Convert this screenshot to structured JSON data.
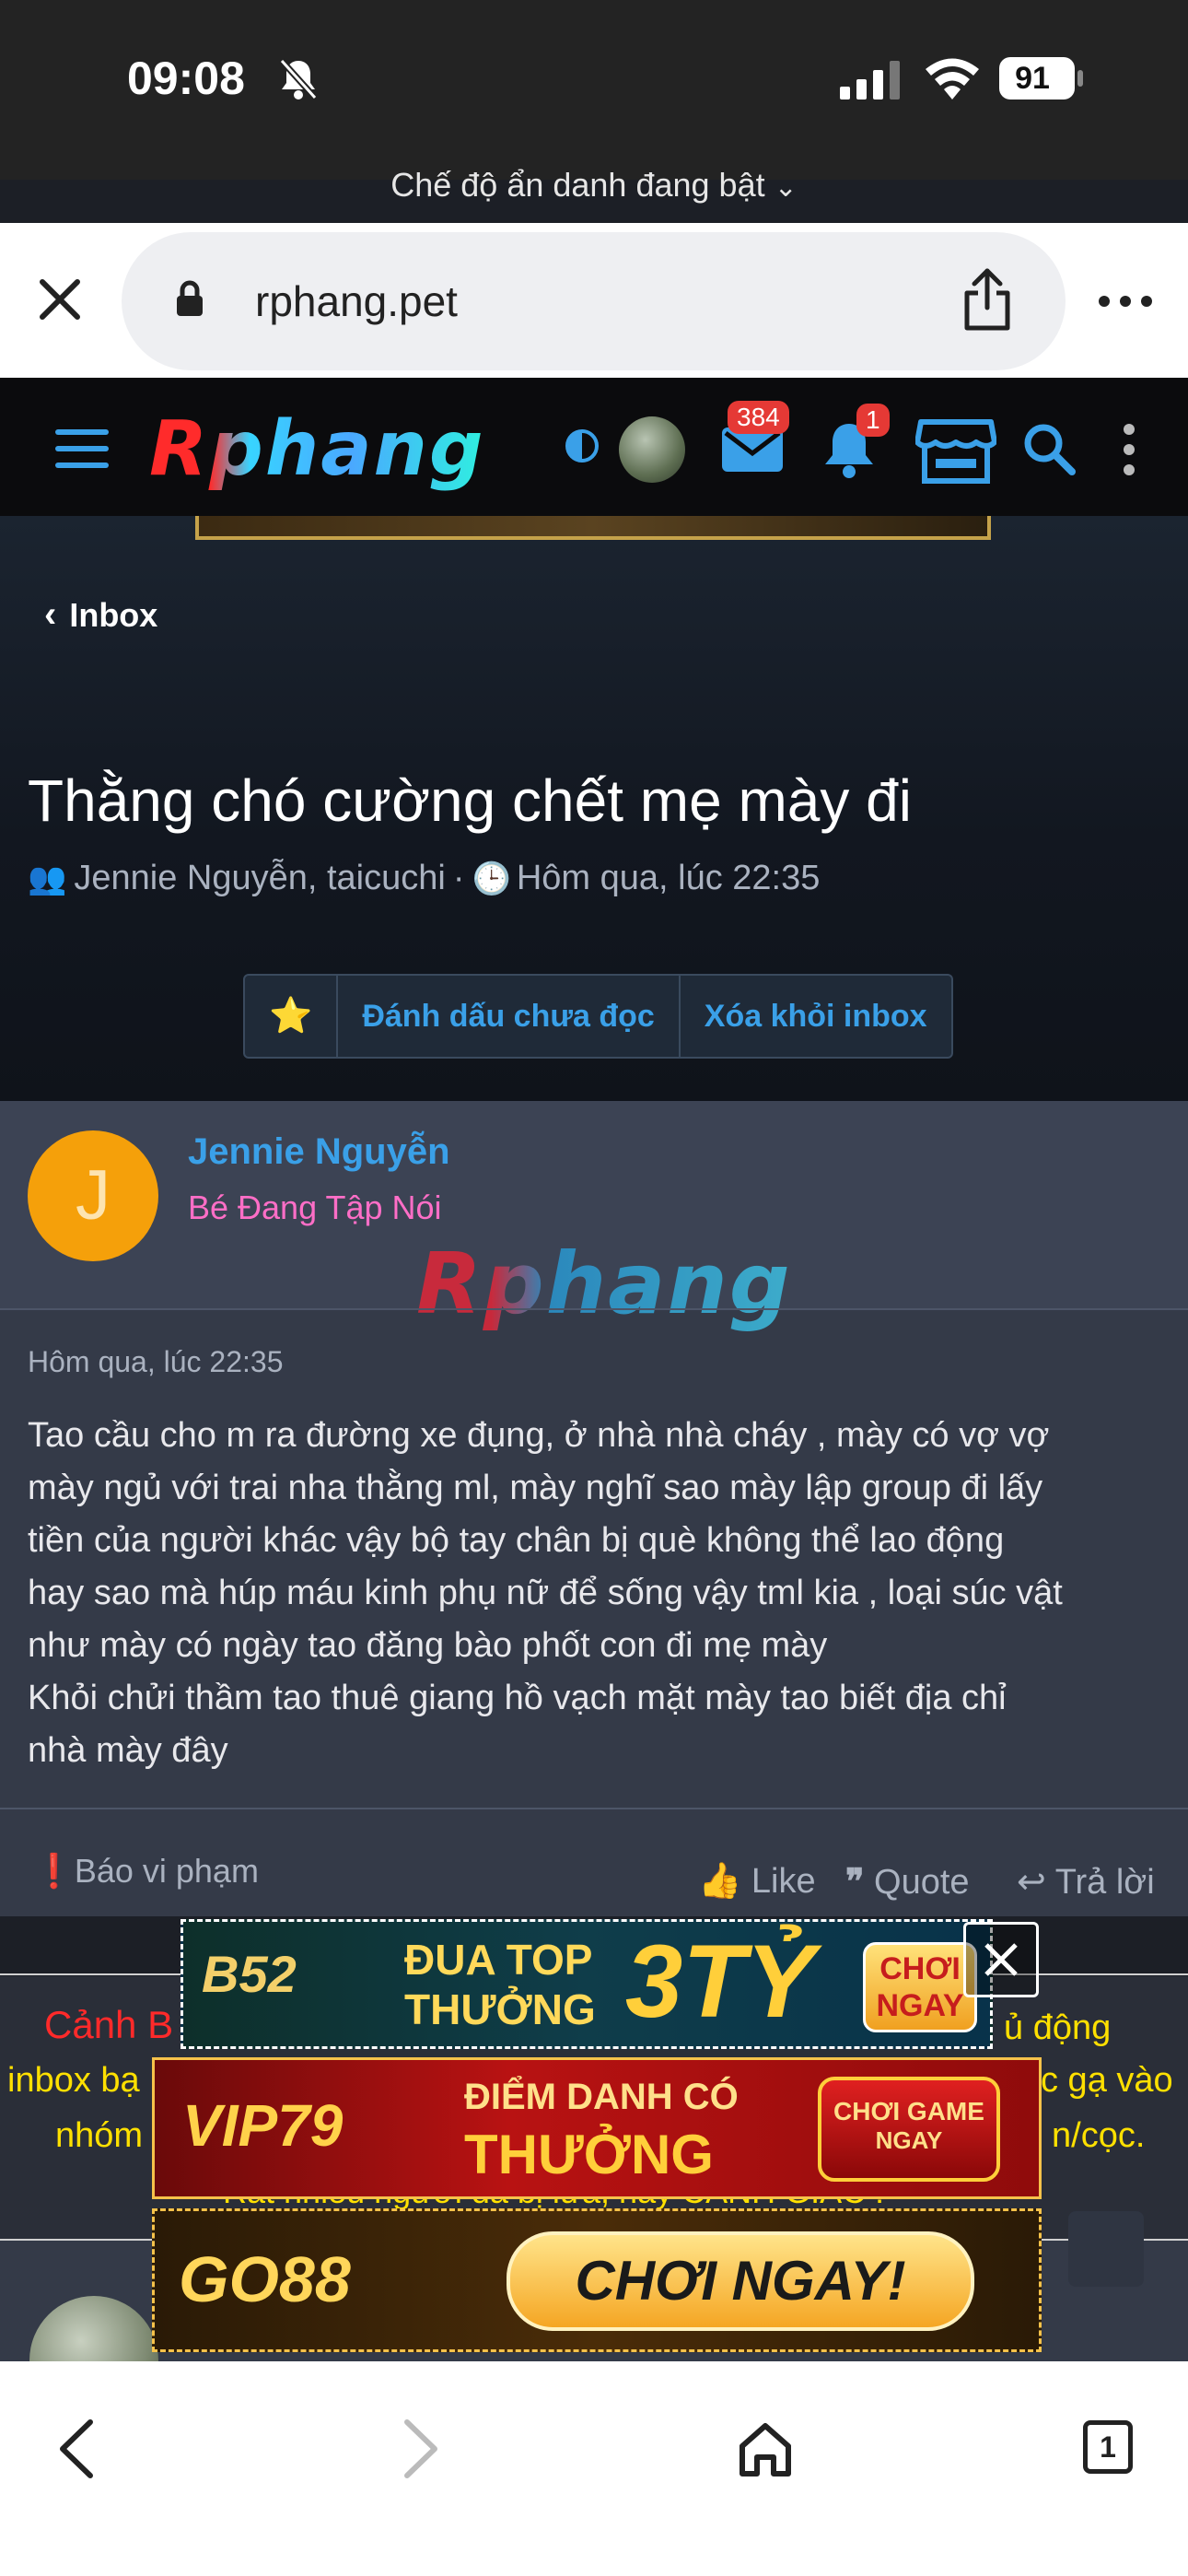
{
  "status_bar": {
    "time": "09:08",
    "battery": "91",
    "incognito_label": "Chế độ ẩn danh đang bật"
  },
  "browser": {
    "url": "rphang.pet"
  },
  "site_header": {
    "logo": "Rphang",
    "inbox_badge": "384",
    "notif_badge": "1"
  },
  "breadcrumb": {
    "back_label": "Inbox"
  },
  "thread": {
    "title": "Thằng chó cường chết mẹ mày đi",
    "participants": "Jennie Nguyễn, taicuchi",
    "separator": "·",
    "time": "Hôm qua, lúc 22:35",
    "actions": {
      "star": "⭐",
      "mark_unread": "Đánh dấu chưa đọc",
      "remove": "Xóa khỏi inbox"
    }
  },
  "message": {
    "avatar_letter": "J",
    "author": "Jennie Nguyễn",
    "rank": "Bé Đang Tập Nói",
    "watermark": "Rphang",
    "date": "Hôm qua, lúc 22:35",
    "lines": [
      "Tao cầu cho m ra đường xe đụng, ở nhà nhà cháy , mày có vợ vợ",
      "mày ngủ với trai nha thằng ml, mày nghĩ sao mày lập group đi lấy",
      "tiền của người khác vậy bộ tay chân bị què không thể lao động",
      "hay sao mà húp máu kinh phụ nữ để sống vậy tml kia , loại súc vật",
      "như mày có ngày tao đăng bào phốt con đi mẹ mày",
      "Khỏi chửi thầm tao thuê giang hồ vạch mặt mày tao biết địa chỉ",
      "nhà mày đây"
    ],
    "report": "Báo vi phạm",
    "like": "Like",
    "quote": "Quote",
    "reply": "Trả lời"
  },
  "warning": {
    "left1": "Cảnh B",
    "left2": "inbox bạ",
    "left3": "nhóm",
    "right1": "ủ động",
    "right2": "c gạ vào",
    "right3": "n/cọc.",
    "bottom": "Rất nhiều người đã bị lừa, hãy CẢNH GIÁC !"
  },
  "ads": {
    "ad1_brand": "B52",
    "ad1_text1": "ĐUA TOP",
    "ad1_text2": "THƯỞNG",
    "ad1_big": "3TỶ",
    "ad1_cta1": "CHƠI",
    "ad1_cta2": "NGAY",
    "ad2_brand": "VIP79",
    "ad2_text1": "ĐIỂM DANH CÓ",
    "ad2_text2": "THƯỞNG",
    "ad2_cta1": "CHƠI GAME",
    "ad2_cta2": "NGAY",
    "ad3_brand": "GO88",
    "ad3_cta": "CHƠI NGAY!"
  },
  "bottom_nav": {
    "tab_count": "1"
  },
  "colors": {
    "accent_blue": "#3aa0e8",
    "avatar_orange": "#f5a00a",
    "rank_pink": "#ff6ec7",
    "warning_red": "#ff2a2a",
    "warning_yellow": "#ffe000",
    "badge_red": "#e53935"
  }
}
